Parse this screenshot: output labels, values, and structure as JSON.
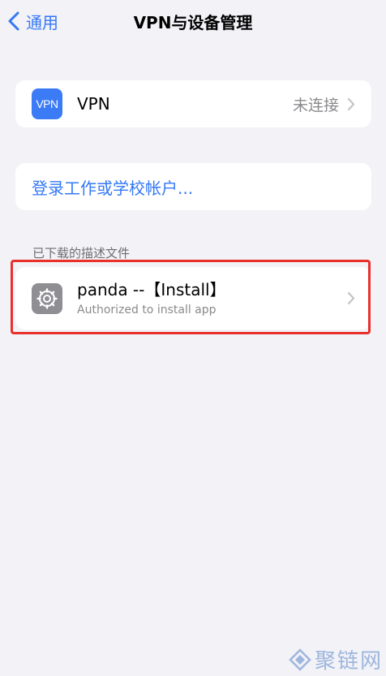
{
  "nav": {
    "back_label": "通用",
    "title": "VPN与设备管理"
  },
  "vpn_row": {
    "icon_text": "VPN",
    "label": "VPN",
    "status": "未连接"
  },
  "account_row": {
    "label": "登录工作或学校帐户..."
  },
  "profiles_section": {
    "header": "已下载的描述文件",
    "items": [
      {
        "title": "panda --【Install】",
        "subtitle": "Authorized to install app",
        "icon": "gear-icon"
      }
    ]
  },
  "highlight_color": "#e8302c",
  "accent_color": "#3478f6",
  "watermark": {
    "text": "聚链网"
  }
}
